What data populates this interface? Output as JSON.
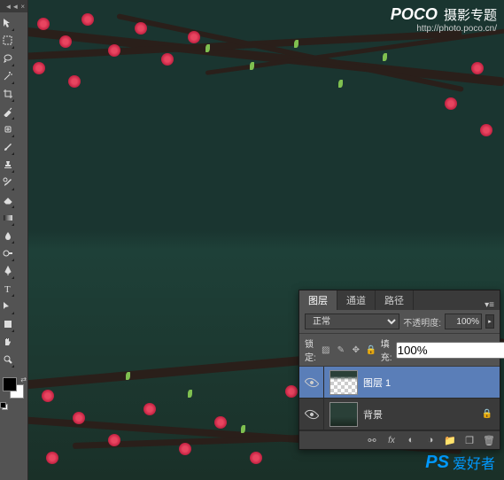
{
  "toolbar": {
    "collapse": "◄◄",
    "close": "×"
  },
  "watermark": {
    "brand": "POCO",
    "brand_text": "摄影专题",
    "url": "http://photo.poco.cn/"
  },
  "bottom_watermark": {
    "logo": "PS",
    "text": "爱好者"
  },
  "layers_panel": {
    "tabs": [
      "图层",
      "通道",
      "路径"
    ],
    "blend_mode": "正常",
    "opacity_label": "不透明度:",
    "opacity_value": "100%",
    "lock_label": "锁定:",
    "fill_label": "填充:",
    "fill_value": "100%",
    "layers": [
      {
        "name": "图层 1",
        "selected": true,
        "thumb_type": "trans",
        "locked": false
      },
      {
        "name": "背景",
        "selected": false,
        "thumb_type": "img",
        "locked": true
      }
    ]
  }
}
